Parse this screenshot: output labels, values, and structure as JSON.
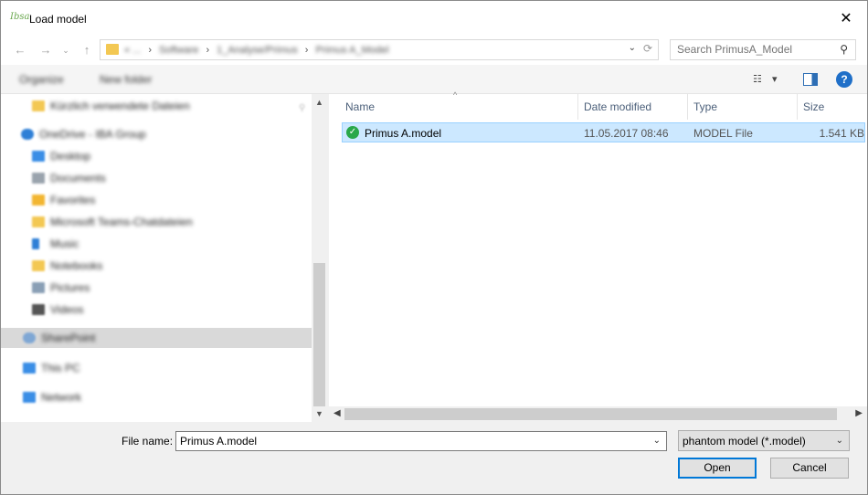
{
  "window": {
    "app_logo": "Ibsa",
    "title": "Load model",
    "close_glyph": "✕"
  },
  "nav": {
    "back_glyph": "←",
    "forward_glyph": "→",
    "up_glyph": "↑",
    "breadcrumbs": [
      "« ...",
      "Software",
      "1_Analyse/Primus",
      "Primus A_Model"
    ],
    "search_placeholder": "Search PrimusA_Model"
  },
  "toolbar": {
    "organize_label": "Organize",
    "new_folder_label": "New folder"
  },
  "sidebar": {
    "items": [
      {
        "label": "Kürzlich verwendete Dateien",
        "color": "#f3c853"
      },
      {
        "label": "OneDrive - IBA Group",
        "color": "#2e7fd6"
      },
      {
        "label": "Desktop",
        "color": "#3a8ee6"
      },
      {
        "label": "Documents",
        "color": "#9aa3ad"
      },
      {
        "label": "Favorites",
        "color": "#f2b632"
      },
      {
        "label": "Microsoft Teams-Chatdateien",
        "color": "#f3c853"
      },
      {
        "label": "Music",
        "color": "#2e7fd6"
      },
      {
        "label": "Notebooks",
        "color": "#f3c853"
      },
      {
        "label": "Pictures",
        "color": "#8a9fb5"
      },
      {
        "label": "Videos",
        "color": "#555555"
      },
      {
        "label": "SharePoint",
        "color": "#7fa7d4"
      },
      {
        "label": "This PC",
        "color": "#3a8ee6"
      },
      {
        "label": "Network",
        "color": "#3a8ee6"
      }
    ]
  },
  "files": {
    "columns": [
      "Name",
      "Date modified",
      "Type",
      "Size"
    ],
    "rows": [
      {
        "name": "Primus A.model",
        "date": "11.05.2017 08:46",
        "type": "MODEL File",
        "size": "1.541 KB"
      }
    ]
  },
  "footer": {
    "filename_label": "File name:",
    "filename_value": "Primus A.model",
    "filter_value": "phantom model (*.model)",
    "open_label": "Open",
    "cancel_label": "Cancel"
  },
  "colors": {
    "selection": "#cce8ff",
    "accent": "#0078d7"
  }
}
